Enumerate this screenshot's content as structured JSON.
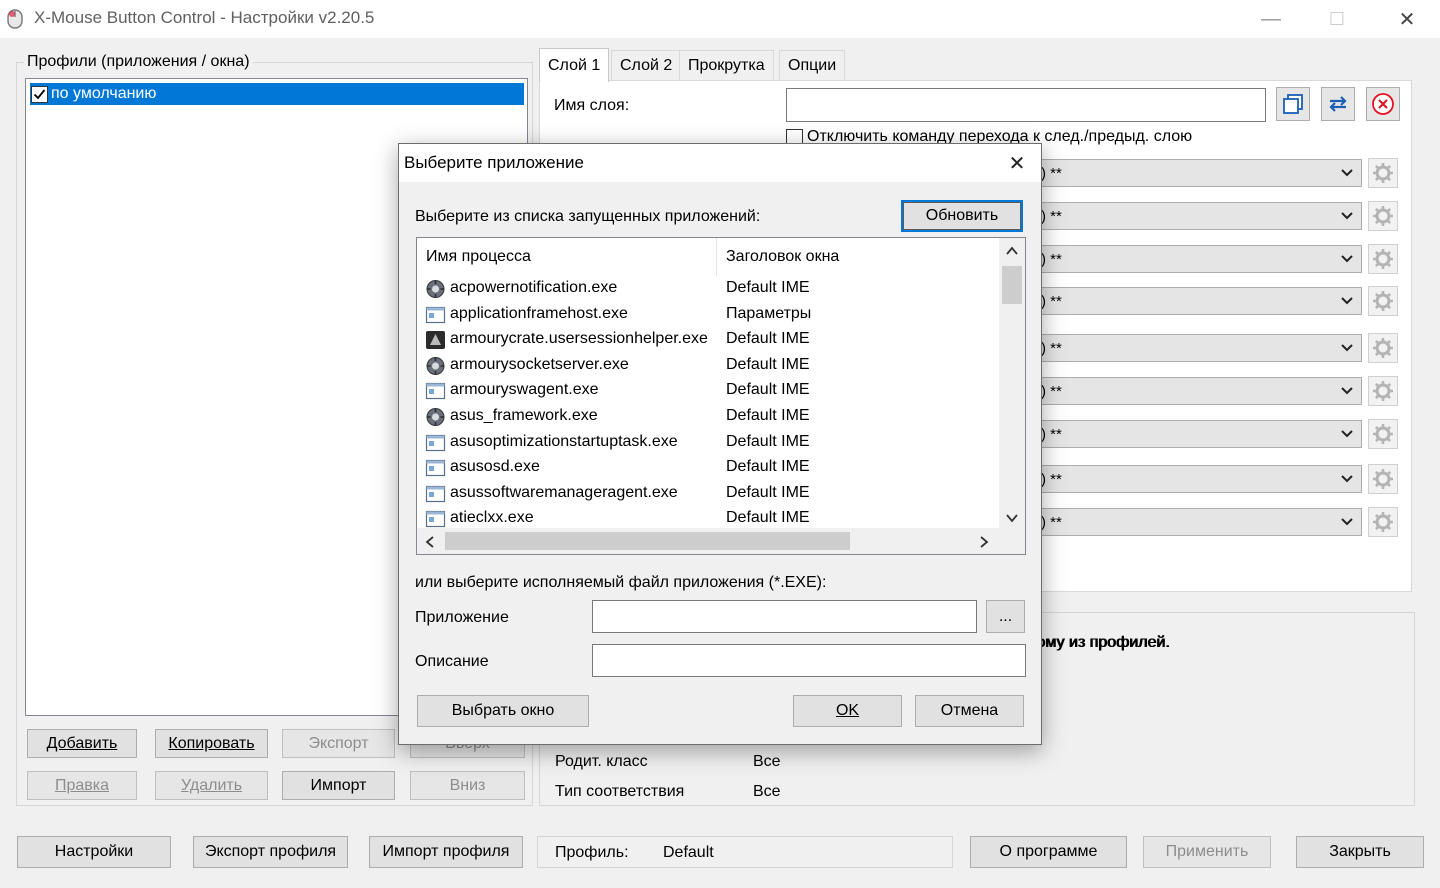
{
  "window": {
    "title": "X-Mouse Button Control - Настройки v2.20.5",
    "controls": {
      "minimize": "—",
      "maximize": "☐",
      "close": "✕"
    }
  },
  "profiles": {
    "group_label": "Профили (приложения / окна)",
    "items": [
      {
        "label": "по умолчанию",
        "checked": true
      }
    ],
    "buttons": {
      "add": "Добавить",
      "copy": "Копировать",
      "export": "Экспорт",
      "up": "Вверх",
      "edit": "Правка",
      "delete": "Удалить",
      "import": "Импорт",
      "down": "Вниз"
    }
  },
  "tabs": [
    "Слой 1",
    "Слой 2",
    "Прокрутка",
    "Опции"
  ],
  "layer": {
    "name_label": "Имя слоя:",
    "name_value": "",
    "disable_switch_label": "Отключить команду перехода к след./предыд. слою",
    "combo_value": ") **",
    "combo_count": 9
  },
  "info": {
    "hint_partial": "ому из профилей.",
    "rows": [
      {
        "label": "Родит. класс",
        "value": "Все"
      },
      {
        "label": "Тип соответствия",
        "value": "Все"
      }
    ]
  },
  "footer": {
    "settings": "Настройки",
    "export_profile": "Экспорт профиля",
    "import_profile": "Импорт профиля",
    "profile_label": "Профиль:",
    "profile_value": "Default",
    "about": "О программе",
    "apply": "Применить",
    "close": "Закрыть"
  },
  "dialog": {
    "title": "Выберите приложение",
    "close": "✕",
    "running_label": "Выберите из списка запущенных приложений:",
    "refresh": "Обновить",
    "columns": {
      "process": "Имя процесса",
      "window_title": "Заголовок окна"
    },
    "processes": [
      {
        "name": "acpowernotification.exe",
        "title": "Default IME",
        "icon": "gear-sphere-icon"
      },
      {
        "name": "applicationframehost.exe",
        "title": "Параметры",
        "icon": "window-icon"
      },
      {
        "name": "armourycrate.usersessionhelper.exe",
        "title": "Default IME",
        "icon": "app-dark-icon"
      },
      {
        "name": "armourysocketserver.exe",
        "title": "Default IME",
        "icon": "gear-sphere-icon"
      },
      {
        "name": "armouryswagent.exe",
        "title": "Default IME",
        "icon": "window-icon"
      },
      {
        "name": "asus_framework.exe",
        "title": "Default IME",
        "icon": "gear-sphere-icon"
      },
      {
        "name": "asusoptimizationstartuptask.exe",
        "title": "Default IME",
        "icon": "window-icon"
      },
      {
        "name": "asusosd.exe",
        "title": "Default IME",
        "icon": "window-icon"
      },
      {
        "name": "asussoftwaremanageragent.exe",
        "title": "Default IME",
        "icon": "window-icon"
      },
      {
        "name": "atieclxx.exe",
        "title": "Default IME",
        "icon": "window-icon"
      }
    ],
    "exe_label": "или выберите исполняемый файл приложения (*.EXE):",
    "app_label": "Приложение",
    "app_value": "",
    "browse": "...",
    "desc_label": "Описание",
    "desc_value": "",
    "pick_window": "Выбрать окно",
    "ok": "OK",
    "cancel": "Отмена"
  },
  "colors": {
    "accent": "#0078d7",
    "close_red": "#e81123",
    "swap_blue": "#1a5fb4"
  }
}
